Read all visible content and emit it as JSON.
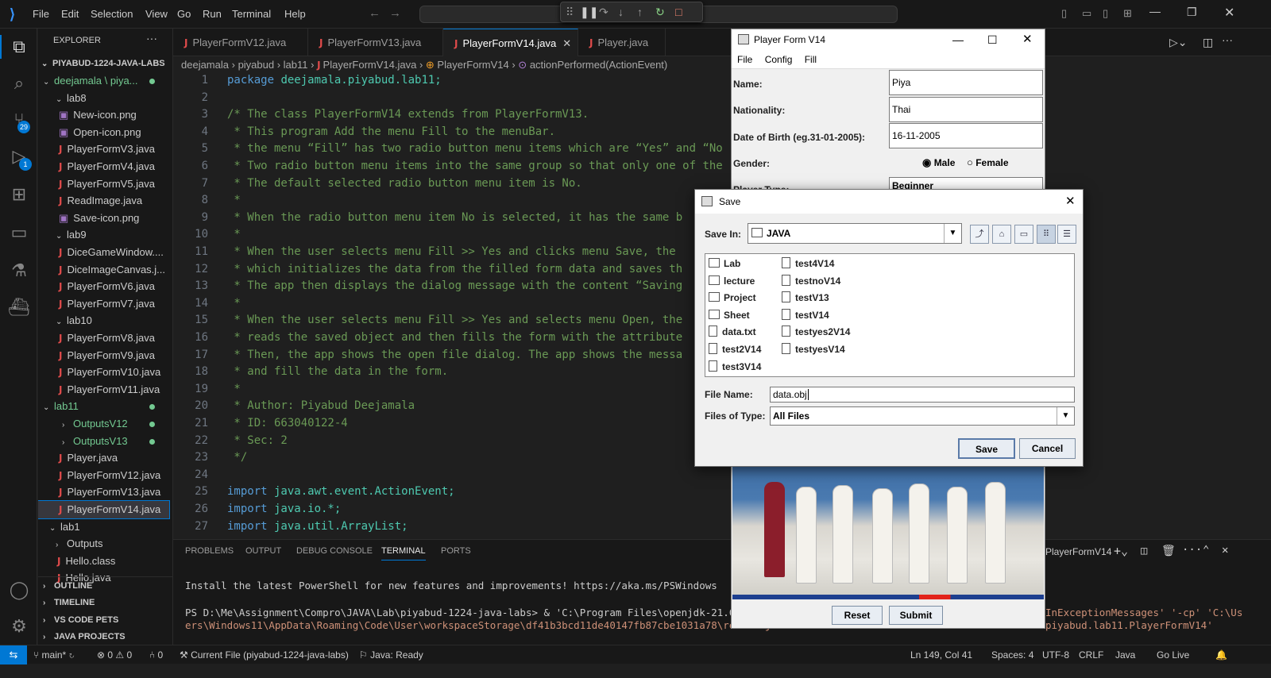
{
  "titlebar": {
    "menus": [
      "File",
      "Edit",
      "Selection",
      "View",
      "Go",
      "Run",
      "Terminal",
      "Help"
    ]
  },
  "activity": {
    "scm_badge": "29",
    "debug_badge": "1"
  },
  "sidebar": {
    "header": "EXPLORER",
    "root": "PIYABUD-1224-JAVA-LABS",
    "items": [
      {
        "label": "deejamala \\ piya...",
        "kind": "folder-green"
      },
      {
        "label": "lab8",
        "kind": "folder"
      },
      {
        "label": "New-icon.png",
        "kind": "img"
      },
      {
        "label": "Open-icon.png",
        "kind": "img"
      },
      {
        "label": "PlayerFormV3.java",
        "kind": "java"
      },
      {
        "label": "PlayerFormV4.java",
        "kind": "java"
      },
      {
        "label": "PlayerFormV5.java",
        "kind": "java"
      },
      {
        "label": "ReadImage.java",
        "kind": "java"
      },
      {
        "label": "Save-icon.png",
        "kind": "img"
      },
      {
        "label": "lab9",
        "kind": "folder"
      },
      {
        "label": "DiceGameWindow....",
        "kind": "java"
      },
      {
        "label": "DiceImageCanvas.j...",
        "kind": "java"
      },
      {
        "label": "PlayerFormV6.java",
        "kind": "java"
      },
      {
        "label": "PlayerFormV7.java",
        "kind": "java"
      },
      {
        "label": "lab10",
        "kind": "folder"
      },
      {
        "label": "PlayerFormV8.java",
        "kind": "java"
      },
      {
        "label": "PlayerFormV9.java",
        "kind": "java"
      },
      {
        "label": "PlayerFormV10.java",
        "kind": "java"
      },
      {
        "label": "PlayerFormV11.java",
        "kind": "java"
      },
      {
        "label": "lab11",
        "kind": "folder-green"
      },
      {
        "label": "OutputsV12",
        "kind": "subfolder-green"
      },
      {
        "label": "OutputsV13",
        "kind": "subfolder-green"
      },
      {
        "label": "Player.java",
        "kind": "java"
      },
      {
        "label": "PlayerFormV12.java",
        "kind": "java"
      },
      {
        "label": "PlayerFormV13.java",
        "kind": "java"
      },
      {
        "label": "PlayerFormV14.java",
        "kind": "java-selected"
      },
      {
        "label": "lab1",
        "kind": "folder"
      },
      {
        "label": "Outputs",
        "kind": "subfolder"
      },
      {
        "label": "Hello.class",
        "kind": "class"
      },
      {
        "label": "Hello.java",
        "kind": "java"
      }
    ],
    "sections": [
      "OUTLINE",
      "TIMELINE",
      "VS CODE PETS",
      "JAVA PROJECTS"
    ]
  },
  "tabs": [
    "PlayerFormV12.java",
    "PlayerFormV13.java",
    "PlayerFormV14.java",
    "Player.java"
  ],
  "breadcrumb": {
    "p1": "deejamala",
    "p2": "piyabud",
    "p3": "lab11",
    "p4": "PlayerFormV14.java",
    "p5": "PlayerFormV14",
    "p6": "actionPerformed(ActionEvent)"
  },
  "code": [
    {
      "n": "1",
      "kw": "package",
      "rest": " deejamala.piyabud.lab11;"
    },
    {
      "n": "2",
      "c": ""
    },
    {
      "n": "3",
      "c": "/* The class PlayerFormV14 extends from PlayerFormV13."
    },
    {
      "n": "4",
      "c": " * This program Add the menu Fill to the menuBar."
    },
    {
      "n": "5",
      "c": " * the menu “Fill” has two radio button menu items which are “Yes” and “No"
    },
    {
      "n": "6",
      "c": " * Two radio button menu items into the same group so that only one of the"
    },
    {
      "n": "7",
      "c": " * The default selected radio button menu item is No."
    },
    {
      "n": "8",
      "c": " *"
    },
    {
      "n": "9",
      "c": " * When the radio button menu item No is selected, it has the same b"
    },
    {
      "n": "10",
      "c": " *"
    },
    {
      "n": "11",
      "c": " * When the user selects menu Fill >> Yes and clicks menu Save, the"
    },
    {
      "n": "12",
      "c": " * which initializes the data from the filled form data and saves th"
    },
    {
      "n": "13",
      "c": " * The app then displays the dialog message with the content “Saving"
    },
    {
      "n": "14",
      "c": " *"
    },
    {
      "n": "15",
      "c": " * When the user selects menu Fill >> Yes and selects menu Open, the"
    },
    {
      "n": "16",
      "c": " * reads the saved object and then fills the form with the attribute"
    },
    {
      "n": "17",
      "c": " * Then, the app shows the open file dialog. The app shows the messa"
    },
    {
      "n": "18",
      "c": " * and fill the data in the form."
    },
    {
      "n": "19",
      "c": " *"
    },
    {
      "n": "20",
      "c": " * Author: Piyabud Deejamala"
    },
    {
      "n": "21",
      "c": " * ID: 663040122-4"
    },
    {
      "n": "22",
      "c": " * Sec: 2"
    },
    {
      "n": "23",
      "c": " */"
    },
    {
      "n": "24",
      "c": ""
    },
    {
      "n": "25",
      "kw": "import",
      "rest": " java.awt.event.ActionEvent;"
    },
    {
      "n": "26",
      "kw": "import",
      "rest": " java.io.*;"
    },
    {
      "n": "27",
      "kw": "import",
      "rest": " java.util.ArrayList;"
    }
  ],
  "panel": {
    "tabs": [
      "PROBLEMS",
      "OUTPUT",
      "DEBUG CONSOLE",
      "TERMINAL",
      "PORTS"
    ],
    "terminal_name": "PlayerFormV14",
    "line1": "Install the latest PowerShell for new features and improvements! https://aka.ms/PSWindows",
    "line2a": "PS D:\\Me\\Assignment\\Compro\\JAVA\\Lab\\piyabud-1224-java-labs>  & 'C:\\Program Files\\openjdk-21.0.1_wind",
    "line2b": "InExceptionMessages' '-cp' 'C:\\Us",
    "line3a": "ers\\Windows11\\AppData\\Roaming\\Code\\User\\workspaceStorage\\df41b3bcd11de40147fb87cbe1031a78\\redhat.jav",
    "line3b": "piyabud.lab11.PlayerFormV14'"
  },
  "status": {
    "branch": "main*",
    "errors": "0",
    "warnings": "0",
    "ports": "0",
    "current_file": "Current File (piyabud-1224-java-labs)",
    "java": "Java: Ready",
    "position": "Ln 149, Col 41",
    "spaces": "Spaces: 4",
    "encoding": "UTF-8",
    "eol": "CRLF",
    "lang": "Java",
    "golive": "Go Live"
  },
  "player": {
    "title": "Player Form V14",
    "menus": [
      "File",
      "Config",
      "Fill"
    ],
    "name_label": "Name:",
    "name": "Piya",
    "nationality_label": "Nationality:",
    "nationality": "Thai",
    "dob_label": "Date of Birth (eg.31-01-2005):",
    "dob": "16-11-2005",
    "gender_label": "Gender:",
    "male": "Male",
    "female": "Female",
    "type_label": "Player Type:",
    "type": "Beginner",
    "reset": "Reset",
    "submit": "Submit"
  },
  "save": {
    "title": "Save",
    "save_in_label": "Save In:",
    "save_in": "JAVA",
    "col1": [
      "Lab",
      "lecture",
      "Project",
      "Sheet",
      "data.txt",
      "test2V14",
      "test3V14"
    ],
    "col2": [
      "test4V14",
      "testnoV14",
      "testV13",
      "testV14",
      "testyes2V14",
      "testyesV14"
    ],
    "filename_label": "File Name:",
    "filename": "data.obj",
    "filetype_label": "Files of Type:",
    "filetype": "All Files",
    "save_btn": "Save",
    "cancel_btn": "Cancel"
  }
}
